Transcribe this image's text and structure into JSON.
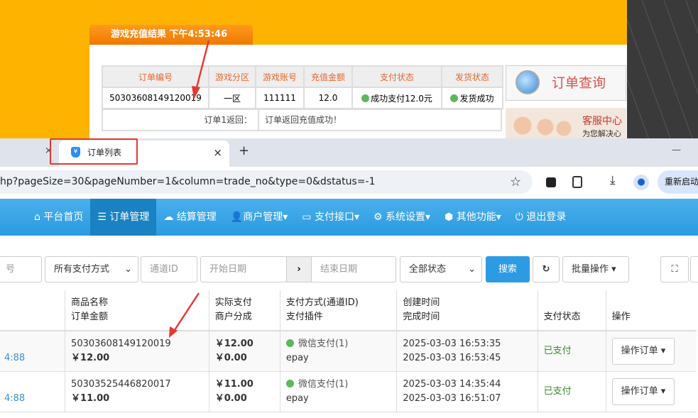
{
  "game": {
    "title": "游戏充值结果 下午4:53:46",
    "headers": [
      "订单编号",
      "游戏分区",
      "游戏账号",
      "充值金额",
      "支付状态",
      "发货状态"
    ],
    "row": [
      "50303608149120019",
      "一区",
      "111111",
      "12.0",
      "成功支付12.0元",
      "发货成功"
    ],
    "return_label": "订单1返回：",
    "return_value": "订单返回充值成功！",
    "query": "订单查询",
    "service": "客服中心",
    "service_sub": "为您解决心"
  },
  "browser": {
    "tab_title": "订单列表",
    "tab_close": "×",
    "new_tab": "+",
    "prev_close": "×",
    "minimize": "—",
    "url": "hp?pageSize=30&pageNumber=1&column=trade_no&type=0&dstatus=-1",
    "restart": "重新启动"
  },
  "nav": [
    "平台首页",
    "订单管理",
    "结算管理",
    "商户管理▾",
    "支付接口▾",
    "系统设置▾",
    "其他功能▾",
    "退出登录"
  ],
  "filters": {
    "order_no": "号",
    "pay_type": "所有支付方式",
    "channel": "通道ID",
    "start": "开始日期",
    "end": "结束日期",
    "status": "全部状态",
    "search": "搜索",
    "batch": "批量操作 ▾"
  },
  "table": {
    "headers": [
      [
        "商品名称",
        "订单金额"
      ],
      [
        "实际支付",
        "商户分成"
      ],
      [
        "支付方式(通道ID)",
        "支付插件"
      ],
      [
        "创建时间",
        "完成时间"
      ],
      [
        "支付状态"
      ],
      [
        "操作"
      ]
    ],
    "rows": [
      {
        "left": "4:88",
        "name": "50303608149120019",
        "amount": "￥12.00",
        "paid": "￥12.00",
        "share": "￥0.00",
        "method": "微信支付(1)",
        "plugin": "epay",
        "created": "2025-03-03 16:53:35",
        "finished": "2025-03-03 16:53:45",
        "status": "已支付",
        "op": "操作订单 ▾"
      },
      {
        "left": "4:88",
        "name": "50303525446820017",
        "amount": "￥11.00",
        "paid": "￥11.00",
        "share": "￥0.00",
        "method": "微信支付(1)",
        "plugin": "epay",
        "created": "2025-03-03 14:35:44",
        "finished": "2025-03-03 16:51:07",
        "status": "已支付",
        "op": "操作订单 ▾"
      }
    ]
  }
}
